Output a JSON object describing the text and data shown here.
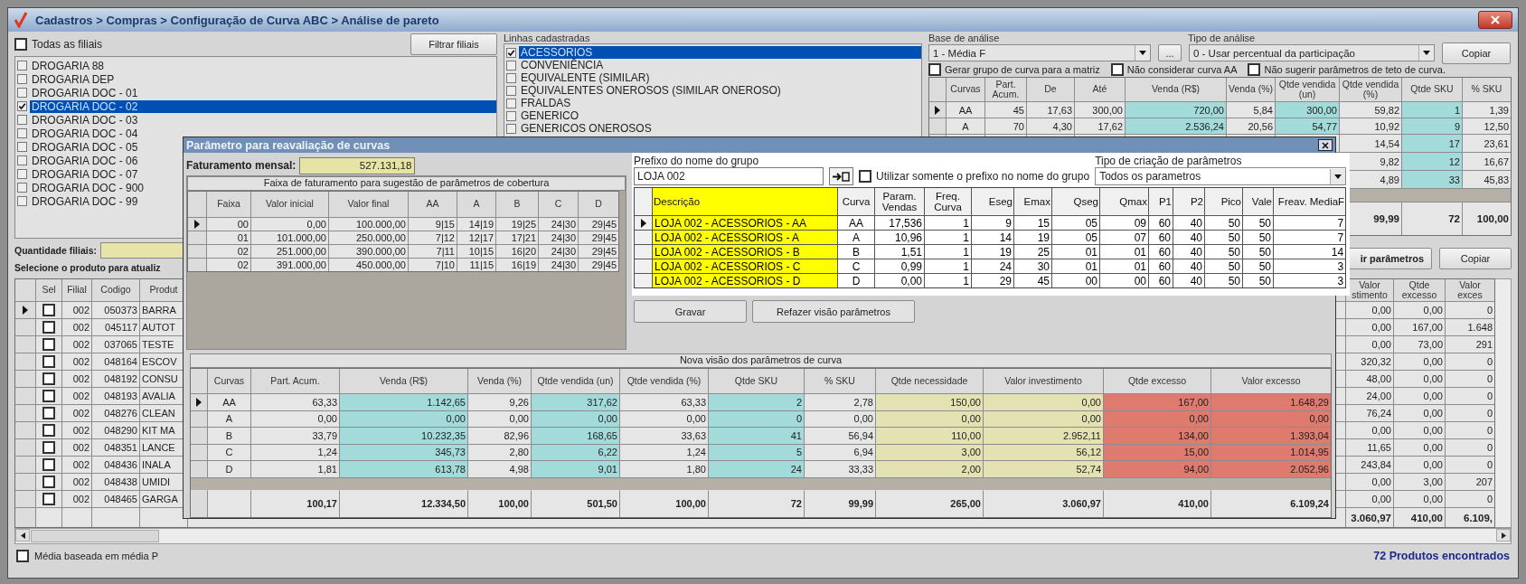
{
  "window": {
    "title": "Cadastros > Compras > Configuração de Curva ABC > Análise de pareto"
  },
  "filiais": {
    "all_label": "Todas as filiais",
    "all_checked": false,
    "filter_button": "Filtrar filiais",
    "items": [
      {
        "label": "DROGARIA 88",
        "checked": false,
        "selected": false
      },
      {
        "label": "DROGARIA DEP",
        "checked": false,
        "selected": false
      },
      {
        "label": "DROGARIA DOC - 01",
        "checked": false,
        "selected": false
      },
      {
        "label": "DROGARIA DOC - 02",
        "checked": true,
        "selected": true
      },
      {
        "label": "DROGARIA DOC - 03",
        "checked": false,
        "selected": false
      },
      {
        "label": "DROGARIA DOC - 04",
        "checked": false,
        "selected": false
      },
      {
        "label": "DROGARIA DOC - 05",
        "checked": false,
        "selected": false
      },
      {
        "label": "DROGARIA DOC - 06",
        "checked": false,
        "selected": false
      },
      {
        "label": "DROGARIA DOC - 07",
        "checked": false,
        "selected": false
      },
      {
        "label": "DROGARIA DOC - 900",
        "checked": false,
        "selected": false
      },
      {
        "label": "DROGARIA DOC - 99",
        "checked": false,
        "selected": false
      }
    ]
  },
  "linhas": {
    "label": "Linhas cadastradas",
    "items": [
      {
        "label": "ACESSORIOS",
        "checked": true,
        "selected": true
      },
      {
        "label": "CONVENIÊNCIA",
        "checked": false,
        "selected": false
      },
      {
        "label": "EQUIVALENTE (SIMILAR)",
        "checked": false,
        "selected": false
      },
      {
        "label": "EQUIVALENTES ONEROSOS (SIMILAR ONEROSO)",
        "checked": false,
        "selected": false
      },
      {
        "label": "FRALDAS",
        "checked": false,
        "selected": false
      },
      {
        "label": "GENERICO",
        "checked": false,
        "selected": false
      },
      {
        "label": "GENERICOS ONEROSOS",
        "checked": false,
        "selected": false
      }
    ]
  },
  "analysis": {
    "base_label": "Base de análise",
    "base_value": "1 - Média F",
    "more_button": "...",
    "type_label": "Tipo de análise",
    "type_value": "0 - Usar percentual da participação",
    "copy_button": "Copiar",
    "options": [
      {
        "label": "Gerar grupo de curva para a matriz",
        "checked": false
      },
      {
        "label": "Não considerar curva AA",
        "checked": false
      },
      {
        "label": "Não sugerir parâmetros de teto de curva.",
        "checked": false
      }
    ]
  },
  "curve_grid": {
    "columns": [
      {
        "label": "Curvas"
      },
      {
        "label": "Part. Acum."
      },
      {
        "label": "De"
      },
      {
        "label": "Até"
      },
      {
        "label": "Venda (R$)",
        "color": "#a3dada"
      },
      {
        "label": "Venda (%)"
      },
      {
        "label": "Qtde vendida (un)",
        "color": "#a3dada"
      },
      {
        "label": "Qtde vendida (%)"
      },
      {
        "label": "Qtde SKU",
        "color": "#a3dada"
      },
      {
        "label": "% SKU"
      }
    ],
    "rows": [
      {
        "selected": true,
        "cells": [
          "AA",
          "45",
          "17,63",
          "300,00",
          "720,00",
          "5,84",
          "300,00",
          "59,82",
          "1",
          "1,39"
        ]
      },
      {
        "selected": false,
        "cells": [
          "A",
          "70",
          "4,30",
          "17,62",
          "2.536,24",
          "20,56",
          "54,77",
          "10,92",
          "9",
          "12,50"
        ]
      },
      {
        "cells": [
          "14,54",
          "17",
          "23,61"
        ]
      },
      {
        "cells": [
          "9,82",
          "12",
          "16,67"
        ]
      },
      {
        "cells": [
          "4,89",
          "33",
          "45,83"
        ]
      }
    ],
    "totals": [
      "99,99",
      "72",
      "100,00"
    ]
  },
  "quantity_label": "Quantidade filiais:",
  "select_prompt": "Selecione o produto para atualiz",
  "parameters_button": "ir parâmetros",
  "copy_button_2": "Copiar",
  "products": {
    "columns": [
      "Sel",
      "Filial",
      "Codigo",
      "Produt",
      "Valor stimento",
      "Qtde excesso",
      "Valor exces"
    ],
    "rows": [
      {
        "selected": true,
        "checked": false,
        "filial": "002",
        "codigo": "050373",
        "produto": "BARRA",
        "valor_investimento": "0,00",
        "qtde_excesso": "0,00",
        "valor_excesso": "0"
      },
      {
        "selected": false,
        "checked": false,
        "filial": "002",
        "codigo": "045117",
        "produto": "AUTOT",
        "valor_investimento": "0,00",
        "qtde_excesso": "167,00",
        "valor_excesso": "1.648"
      },
      {
        "selected": false,
        "checked": false,
        "filial": "002",
        "codigo": "037065",
        "produto": "TESTE",
        "valor_investimento": "0,00",
        "qtde_excesso": "73,00",
        "valor_excesso": "291"
      },
      {
        "selected": false,
        "checked": false,
        "filial": "002",
        "codigo": "048164",
        "produto": "ESCOV",
        "valor_investimento": "320,32",
        "qtde_excesso": "0,00",
        "valor_excesso": "0"
      },
      {
        "selected": false,
        "checked": false,
        "filial": "002",
        "codigo": "048192",
        "produto": "CONSU",
        "valor_investimento": "48,00",
        "qtde_excesso": "0,00",
        "valor_excesso": "0"
      },
      {
        "selected": false,
        "checked": false,
        "filial": "002",
        "codigo": "048193",
        "produto": "AVALIA",
        "valor_investimento": "24,00",
        "qtde_excesso": "0,00",
        "valor_excesso": "0"
      },
      {
        "selected": false,
        "checked": false,
        "filial": "002",
        "codigo": "048276",
        "produto": "CLEAN",
        "valor_investimento": "76,24",
        "qtde_excesso": "0,00",
        "valor_excesso": "0"
      },
      {
        "selected": false,
        "checked": false,
        "filial": "002",
        "codigo": "048290",
        "produto": "KIT MA",
        "valor_investimento": "0,00",
        "qtde_excesso": "0,00",
        "valor_excesso": "0"
      },
      {
        "selected": false,
        "checked": false,
        "filial": "002",
        "codigo": "048351",
        "produto": "LANCE",
        "valor_investimento": "11,65",
        "qtde_excesso": "0,00",
        "valor_excesso": "0"
      },
      {
        "selected": false,
        "checked": false,
        "filial": "002",
        "codigo": "048436",
        "produto": "INALA",
        "valor_investimento": "243,84",
        "qtde_excesso": "0,00",
        "valor_excesso": "0"
      },
      {
        "selected": false,
        "checked": false,
        "filial": "002",
        "codigo": "048438",
        "produto": "UMIDI",
        "valor_investimento": "0,00",
        "qtde_excesso": "3,00",
        "valor_excesso": "207"
      },
      {
        "selected": false,
        "checked": false,
        "filial": "002",
        "codigo": "048465",
        "produto": "GARGA",
        "valor_investimento": "0,00",
        "qtde_excesso": "0,00",
        "valor_excesso": "0"
      }
    ],
    "totals": [
      "3.060,97",
      "410,00",
      "6.109,"
    ]
  },
  "status": {
    "media_label": "Média baseada em média P",
    "media_checked": false,
    "count": "72 Produtos encontrados"
  },
  "dialog": {
    "title": "Parâmetro para reavaliação de curvas",
    "revenue_label": "Faturamento mensal:",
    "revenue_value": "527.131,18",
    "faixa": {
      "caption": "Faixa de faturamento para sugestão de parâmetros de cobertura",
      "columns": [
        "Faixa",
        "Valor inicial",
        "Valor final",
        "AA",
        "A",
        "B",
        "C",
        "D"
      ],
      "rows": [
        {
          "selected": true,
          "cells": [
            "00",
            "0,00",
            "100.000,00",
            "9|15",
            "14|19",
            "19|25",
            "24|30",
            "29|45"
          ]
        },
        {
          "selected": false,
          "cells": [
            "01",
            "101.000,00",
            "250.000,00",
            "7|12",
            "12|17",
            "17|21",
            "24|30",
            "29|45"
          ]
        },
        {
          "selected": false,
          "cells": [
            "02",
            "251.000,00",
            "390.000,00",
            "7|11",
            "10|15",
            "16|20",
            "24|30",
            "29|45"
          ]
        },
        {
          "selected": false,
          "cells": [
            "02",
            "391.000,00",
            "450.000,00",
            "7|10",
            "11|15",
            "16|19",
            "24|30",
            "29|45"
          ]
        }
      ]
    },
    "prefix_label": "Prefixo do nome do grupo",
    "prefix_value": "LOJA 002",
    "prefix_only_label": "Utilizar somente o prefixo no nome do grupo",
    "prefix_only_checked": false,
    "creation_type_label": "Tipo de criação de parâmetros",
    "creation_type_value": "Todos os parametros",
    "params": {
      "columns": [
        {
          "label": "Descrição",
          "color": "#ffff00"
        },
        {
          "label": "Curva"
        },
        {
          "label": "Param. Vendas"
        },
        {
          "label": "Freq. Curva"
        },
        {
          "label": "Eseg"
        },
        {
          "label": "Emax"
        },
        {
          "label": "Qseg"
        },
        {
          "label": "Qmax"
        },
        {
          "label": "P1"
        },
        {
          "label": "P2"
        },
        {
          "label": "Pico"
        },
        {
          "label": "Vale"
        },
        {
          "label": "Freav. MediaF"
        }
      ],
      "rows": [
        {
          "selected": true,
          "cells": [
            "LOJA 002 - ACESSORIOS - AA",
            "AA",
            "17,536",
            "1",
            "9",
            "15",
            "05",
            "09",
            "60",
            "40",
            "50",
            "50",
            "7"
          ]
        },
        {
          "selected": false,
          "cells": [
            "LOJA 002 - ACESSORIOS - A",
            "A",
            "10,96",
            "1",
            "14",
            "19",
            "05",
            "07",
            "60",
            "40",
            "50",
            "50",
            "7"
          ]
        },
        {
          "selected": false,
          "cells": [
            "LOJA 002 - ACESSORIOS - B",
            "B",
            "1,51",
            "1",
            "19",
            "25",
            "01",
            "01",
            "60",
            "40",
            "50",
            "50",
            "14"
          ]
        },
        {
          "selected": false,
          "cells": [
            "LOJA 002 - ACESSORIOS - C",
            "C",
            "0,99",
            "1",
            "24",
            "30",
            "01",
            "01",
            "60",
            "40",
            "50",
            "50",
            "3"
          ]
        },
        {
          "selected": false,
          "cells": [
            "LOJA 002 - ACESSORIOS - D",
            "D",
            "0,00",
            "1",
            "29",
            "45",
            "00",
            "00",
            "60",
            "40",
            "50",
            "50",
            "3"
          ]
        }
      ]
    },
    "buttons": [
      "Gravar",
      "Refazer visão parâmetros"
    ],
    "new_view": {
      "caption": "Nova visão dos parâmetros de curva",
      "columns": [
        {
          "label": "Curvas"
        },
        {
          "label": "Part. Acum."
        },
        {
          "label": "Venda (R$)",
          "color": "#a3dada"
        },
        {
          "label": "Venda (%)"
        },
        {
          "label": "Qtde vendida (un)",
          "color": "#a3dada"
        },
        {
          "label": "Qtde vendida (%)"
        },
        {
          "label": "Qtde SKU",
          "color": "#a3dada"
        },
        {
          "label": "% SKU"
        },
        {
          "label": "Qtde necessidade",
          "color": "#e4e2b2"
        },
        {
          "label": "Valor investimento",
          "color": "#e4e2b2"
        },
        {
          "label": "Qtde excesso",
          "color": "#df7a6e"
        },
        {
          "label": "Valor excesso",
          "color": "#df7a6e"
        }
      ],
      "rows": [
        {
          "selected": true,
          "cells": [
            "AA",
            "63,33",
            "1.142,65",
            "9,26",
            "317,62",
            "63,33",
            "2",
            "2,78",
            "150,00",
            "0,00",
            "167,00",
            "1.648,29"
          ]
        },
        {
          "selected": false,
          "cells": [
            "A",
            "0,00",
            "0,00",
            "0,00",
            "0,00",
            "0,00",
            "0",
            "0,00",
            "0,00",
            "0,00",
            "0,00",
            "0,00"
          ]
        },
        {
          "selected": false,
          "cells": [
            "B",
            "33,79",
            "10.232,35",
            "82,96",
            "168,65",
            "33,63",
            "41",
            "56,94",
            "110,00",
            "2.952,11",
            "134,00",
            "1.393,04"
          ]
        },
        {
          "selected": false,
          "cells": [
            "C",
            "1,24",
            "345,73",
            "2,80",
            "6,22",
            "1,24",
            "5",
            "6,94",
            "3,00",
            "56,12",
            "15,00",
            "1.014,95"
          ]
        },
        {
          "selected": false,
          "cells": [
            "D",
            "1,81",
            "613,78",
            "4,98",
            "9,01",
            "1,80",
            "24",
            "33,33",
            "2,00",
            "52,74",
            "94,00",
            "2.052,96"
          ]
        }
      ],
      "totals": [
        "100,17",
        "12.334,50",
        "100,00",
        "501,50",
        "100,00",
        "72",
        "99,99",
        "265,00",
        "3.060,97",
        "410,00",
        "6.109,24"
      ]
    }
  }
}
